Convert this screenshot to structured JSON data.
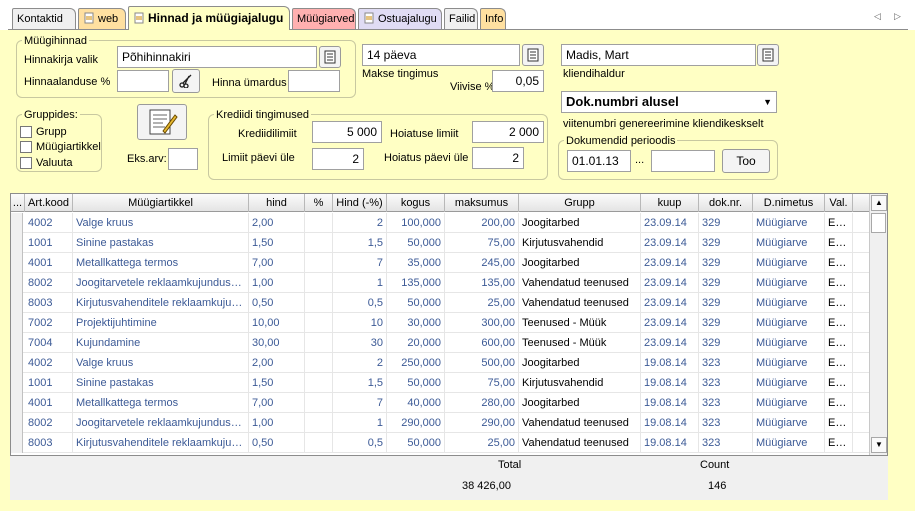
{
  "tabs": [
    {
      "label": "Kontaktid",
      "icon": ""
    },
    {
      "label": "web",
      "icon": "document-icon"
    },
    {
      "label": "Hinnad ja müügiajalugu",
      "icon": "document-icon"
    },
    {
      "label": "Müügiarved",
      "icon": ""
    },
    {
      "label": "Ostuajalugu",
      "icon": "document-icon"
    },
    {
      "label": "Failid",
      "icon": ""
    },
    {
      "label": "Info",
      "icon": ""
    }
  ],
  "nav": {
    "prev": "◁",
    "next": "▷"
  },
  "pricing": {
    "group_title": "Müügihinnad",
    "price_list_label": "Hinnakirja valik",
    "price_list_value": "Põhihinnakiri",
    "discount_label": "Hinnaalanduse %",
    "discount_value": "",
    "rounding_label": "Hinna ümardus",
    "rounding_value": "",
    "payment_value": "14 päeva",
    "payment_label": "Makse tingimus",
    "penalty_label": "Viivise %",
    "penalty_value": "0,05",
    "manager_value": "Madis, Mart",
    "manager_label": "kliendihaldur",
    "refnum_value": "Dok.numbri alusel",
    "refnum_desc": "viitenumbri genereerimine kliendikeskselt"
  },
  "groups": {
    "title": "Gruppides:",
    "options": [
      "Grupp",
      "Müügiartikkel",
      "Valuuta"
    ]
  },
  "copies": {
    "label": "Eks.arv:",
    "value": ""
  },
  "credit": {
    "title": "Krediidi tingimused",
    "limit_label": "Krediidilimiit",
    "limit_value": "5 000",
    "warn_limit_label": "Hoiatuse limiit",
    "warn_limit_value": "2 000",
    "over_days_label": "Limiit päevi üle",
    "over_days_value": "2",
    "warn_days_label": "Hoiatus päevi üle",
    "warn_days_value": "2"
  },
  "period": {
    "title": "Dokumendid perioodis",
    "from": "01.01.13",
    "sep": "...",
    "to": "",
    "button": "Too"
  },
  "table": {
    "columns": [
      "...",
      "Art.kood",
      "Müügiartikkel",
      "hind",
      "%",
      "Hind (-%)",
      "kogus",
      "maksumus",
      "Grupp",
      "kuup",
      "dok.nr.",
      "D.nimetus",
      "Val."
    ],
    "rows": [
      [
        "4002",
        "Valge kruus",
        "2,00",
        "",
        "2",
        "100,000",
        "200,00",
        "Joogitarbed",
        "23.09.14",
        "329",
        "Müügiarve",
        "EUR"
      ],
      [
        "1001",
        "Sinine pastakas",
        "1,50",
        "",
        "1,5",
        "50,000",
        "75,00",
        "Kirjutusvahendid",
        "23.09.14",
        "329",
        "Müügiarve",
        "EUR"
      ],
      [
        "4001",
        "Metallkattega termos",
        "7,00",
        "",
        "7",
        "35,000",
        "245,00",
        "Joogitarbed",
        "23.09.14",
        "329",
        "Müügiarve",
        "EUR"
      ],
      [
        "8002",
        "Joogitarvetele reklaamkujunduse ...",
        "1,00",
        "",
        "1",
        "135,000",
        "135,00",
        "Vahendatud teenused",
        "23.09.14",
        "329",
        "Müügiarve",
        "EUR"
      ],
      [
        "8003",
        "Kirjutusvahenditele reklaamkujund...",
        "0,50",
        "",
        "0,5",
        "50,000",
        "25,00",
        "Vahendatud teenused",
        "23.09.14",
        "329",
        "Müügiarve",
        "EUR"
      ],
      [
        "7002",
        "Projektijuhtimine",
        "10,00",
        "",
        "10",
        "30,000",
        "300,00",
        "Teenused - Müük",
        "23.09.14",
        "329",
        "Müügiarve",
        "EUR"
      ],
      [
        "7004",
        "Kujundamine",
        "30,00",
        "",
        "30",
        "20,000",
        "600,00",
        "Teenused - Müük",
        "23.09.14",
        "329",
        "Müügiarve",
        "EUR"
      ],
      [
        "4002",
        "Valge kruus",
        "2,00",
        "",
        "2",
        "250,000",
        "500,00",
        "Joogitarbed",
        "19.08.14",
        "323",
        "Müügiarve",
        "EUR"
      ],
      [
        "1001",
        "Sinine pastakas",
        "1,50",
        "",
        "1,5",
        "50,000",
        "75,00",
        "Kirjutusvahendid",
        "19.08.14",
        "323",
        "Müügiarve",
        "EUR"
      ],
      [
        "4001",
        "Metallkattega termos",
        "7,00",
        "",
        "7",
        "40,000",
        "280,00",
        "Joogitarbed",
        "19.08.14",
        "323",
        "Müügiarve",
        "EUR"
      ],
      [
        "8002",
        "Joogitarvetele reklaamkujunduse ...",
        "1,00",
        "",
        "1",
        "290,000",
        "290,00",
        "Vahendatud teenused",
        "19.08.14",
        "323",
        "Müügiarve",
        "EUR"
      ],
      [
        "8003",
        "Kirjutusvahenditele reklaamkujund...",
        "0,50",
        "",
        "0,5",
        "50,000",
        "25,00",
        "Vahendatud teenused",
        "19.08.14",
        "323",
        "Müügiarve",
        "EUR"
      ]
    ]
  },
  "footer": {
    "total_label": "Total",
    "total_value": "38 426,00",
    "count_label": "Count",
    "count_value": "146"
  },
  "colors": {
    "background": "#ffffc4",
    "link_text": "#3c5a96",
    "tab_pink": "#ffb0b0",
    "tab_orange": "#ffe0a0"
  }
}
